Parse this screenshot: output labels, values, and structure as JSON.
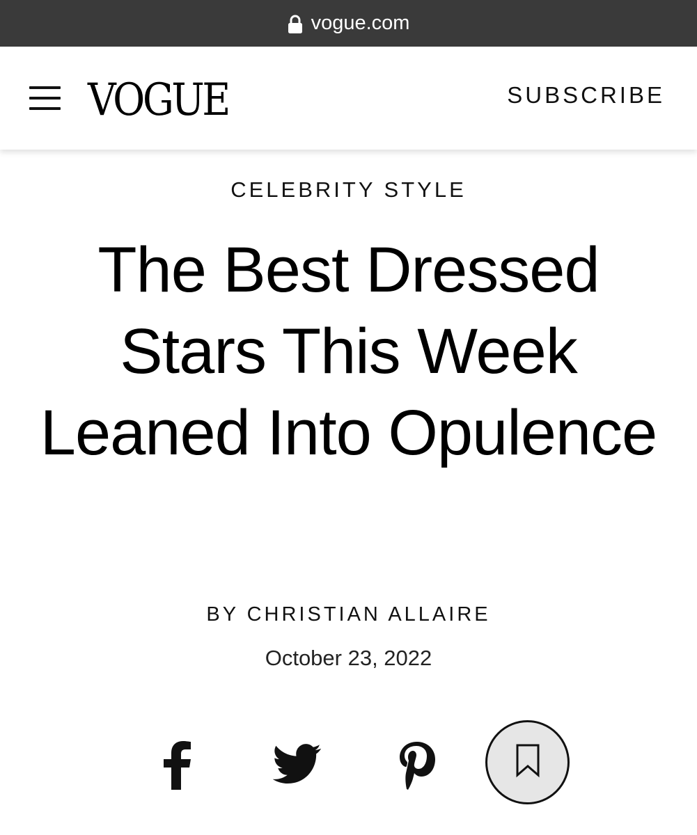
{
  "browser": {
    "url": "vogue.com",
    "icon": "lock-icon"
  },
  "header": {
    "logo": "VOGUE",
    "menu_icon": "hamburger-icon",
    "subscribe_label": "SUBSCRIBE"
  },
  "article": {
    "category": "CELEBRITY STYLE",
    "headline": "The Best Dressed Stars This Week Leaned Into Opulence",
    "byline_prefix": "BY",
    "author": "CHRISTIAN ALLAIRE",
    "date": "October 23, 2022"
  },
  "share": {
    "icons": [
      "facebook-icon",
      "twitter-icon",
      "pinterest-icon",
      "bookmark-icon"
    ]
  },
  "colors": {
    "urlbar_bg": "#3a3a3a",
    "text": "#000000",
    "bookmark_bg": "#e6e6e6"
  }
}
